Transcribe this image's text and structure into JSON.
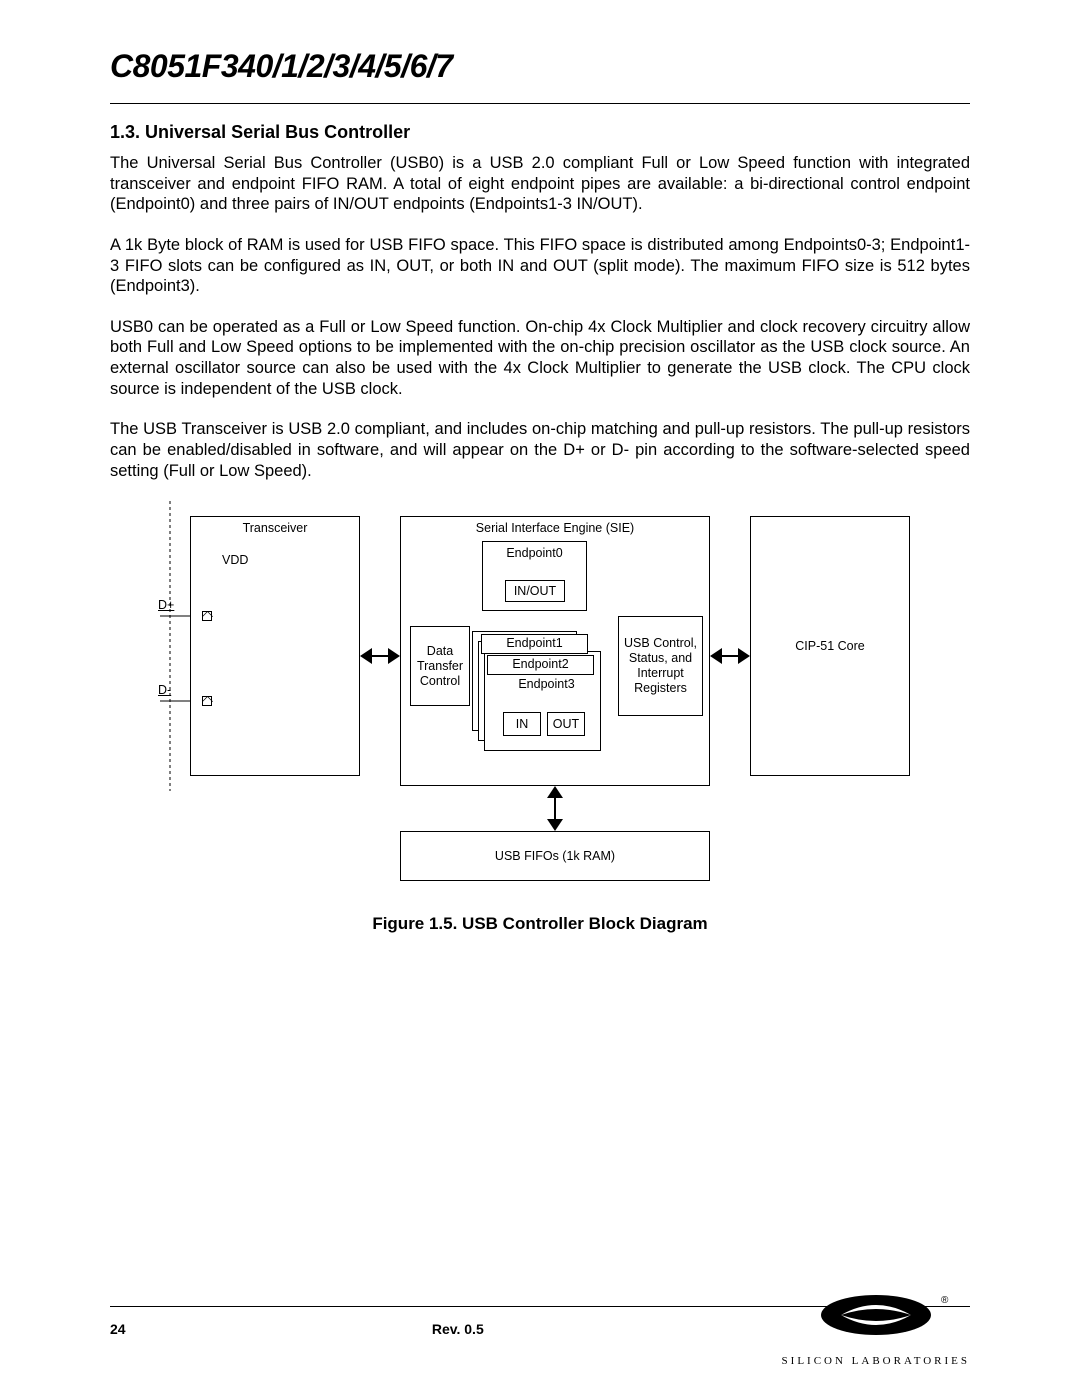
{
  "header": {
    "chip_title": "C8051F340/1/2/3/4/5/6/7"
  },
  "section": {
    "number_title": "1.3.    Universal Serial Bus Controller",
    "p1": "The Universal Serial Bus Controller (USB0) is a USB 2.0 compliant Full or Low Speed function with integrated transceiver and endpoint FIFO RAM. A total of eight endpoint pipes are available: a bi-directional control endpoint (Endpoint0) and three pairs of IN/OUT endpoints (Endpoints1-3 IN/OUT).",
    "p2": "A 1k Byte block of RAM is used for USB FIFO space. This FIFO space is distributed among Endpoints0-3; Endpoint1-3 FIFO slots can be configured as IN, OUT, or both IN and OUT (split mode). The maximum FIFO size is 512 bytes (Endpoint3).",
    "p3": "USB0 can be operated as a Full or Low Speed function. On-chip 4x Clock Multiplier and clock recovery circuitry allow both Full and Low Speed options to be implemented with the on-chip precision oscillator as the USB clock source. An external oscillator source can also be used with the 4x Clock Multiplier to generate the USB clock. The CPU clock source is independent of the USB clock.",
    "p4": "The USB Transceiver is USB 2.0 compliant, and includes on-chip matching and pull-up resistors. The pull-up resistors can be enabled/disabled in software, and will appear on the D+ or D- pin according to the software-selected speed setting (Full or Low Speed)."
  },
  "figure_caption": "Figure 1.5. USB Controller Block Diagram",
  "diagram": {
    "transceiver": "Transceiver",
    "vdd": "VDD",
    "dplus": "D+",
    "dminus": "D-",
    "sie": "Serial Interface Engine (SIE)",
    "data_transfer_control": "Data Transfer Control",
    "endpoint0": "Endpoint0",
    "inout": "IN/OUT",
    "endpoint1": "Endpoint1",
    "endpoint2": "Endpoint2",
    "endpoint3": "Endpoint3",
    "in": "IN",
    "out": "OUT",
    "usb_regs": "USB Control, Status, and Interrupt Registers",
    "cip51": "CIP-51 Core",
    "usb_fifos": "USB FIFOs (1k RAM)"
  },
  "footer": {
    "page": "24",
    "rev": "Rev. 0.5",
    "company": "SILICON LABORATORIES"
  }
}
